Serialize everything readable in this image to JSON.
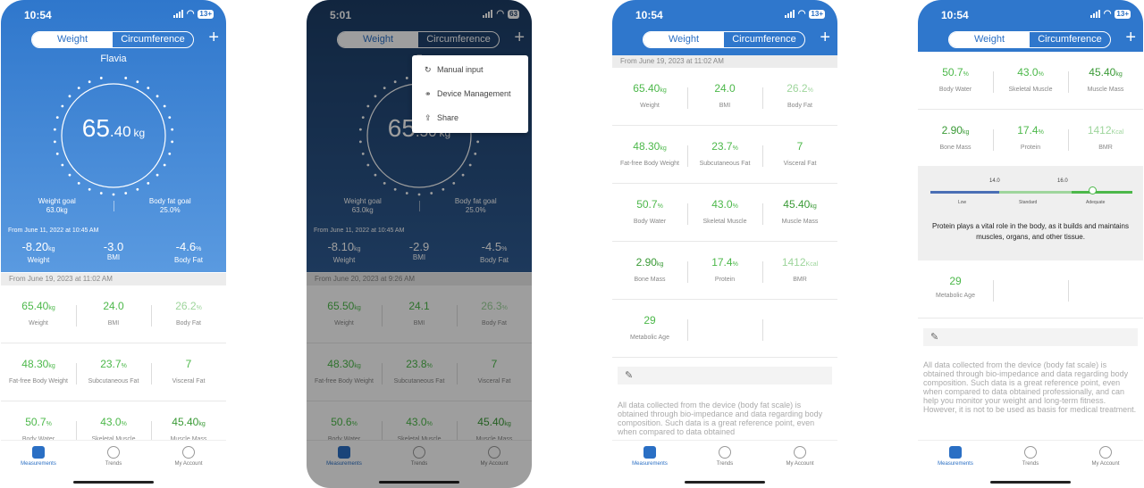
{
  "colors": {
    "brand_blue": "#2f77cc",
    "green": "#4cb84a",
    "light_green": "#9ed59c"
  },
  "tabs": {
    "measurements": "Measurements",
    "trends": "Trends",
    "account": "My Account"
  },
  "seg": {
    "weight": "Weight",
    "circ": "Circumference"
  },
  "icons": {
    "plus": "+",
    "note": "✎",
    "measurements": "shield-icon",
    "trends": "pulse-icon",
    "account": "person-icon"
  },
  "s1": {
    "time": "10:54",
    "battery": "13+",
    "user": "Flavia",
    "weight": "65",
    "weight_dec": ".40",
    "unit": "kg",
    "goals": [
      {
        "label": "Weight goal",
        "value": "63.0kg"
      },
      {
        "label": "Body fat goal",
        "value": "25.0%"
      }
    ],
    "since": "From June 11, 2022 at 10:45 AM",
    "deltas": [
      {
        "v": "-8.20",
        "u": "kg",
        "l": "Weight"
      },
      {
        "v": "-3.0",
        "u": "",
        "l": "BMI"
      },
      {
        "v": "-4.6",
        "u": "%",
        "l": "Body Fat"
      }
    ],
    "date": "From June 19, 2023 at 11:02 AM",
    "rows": [
      [
        {
          "v": "65.40",
          "u": "kg",
          "l": "Weight"
        },
        {
          "v": "24.0",
          "u": "",
          "l": "BMI"
        },
        {
          "v": "26.2",
          "u": "%",
          "l": "Body Fat"
        }
      ],
      [
        {
          "v": "48.30",
          "u": "kg",
          "l": "Fat-free Body Weight"
        },
        {
          "v": "23.7",
          "u": "%",
          "l": "Subcutaneous Fat"
        },
        {
          "v": "7",
          "u": "",
          "l": "Visceral Fat"
        }
      ],
      [
        {
          "v": "50.7",
          "u": "%",
          "l": "Body Water"
        },
        {
          "v": "43.0",
          "u": "%",
          "l": "Skeletal Muscle"
        },
        {
          "v": "45.40",
          "u": "kg",
          "l": "Muscle Mass"
        }
      ]
    ]
  },
  "s2": {
    "time": "5:01",
    "battery": "63",
    "user": "F",
    "weight": "65",
    "weight_dec": ".50",
    "unit": "kg",
    "menu": [
      {
        "icon": "↻",
        "label": "Manual input"
      },
      {
        "icon": "⚭",
        "label": "Device Management"
      },
      {
        "icon": "⇪",
        "label": "Share"
      }
    ],
    "goals": [
      {
        "label": "Weight goal",
        "value": "63.0kg"
      },
      {
        "label": "Body fat goal",
        "value": "25.0%"
      }
    ],
    "since": "From June 11, 2022 at 10:45 AM",
    "deltas": [
      {
        "v": "-8.10",
        "u": "kg",
        "l": "Weight"
      },
      {
        "v": "-2.9",
        "u": "",
        "l": "BMI"
      },
      {
        "v": "-4.5",
        "u": "%",
        "l": "Body Fat"
      }
    ],
    "date": "From June 20, 2023 at 9:26 AM",
    "rows": [
      [
        {
          "v": "65.50",
          "u": "kg",
          "l": "Weight"
        },
        {
          "v": "24.1",
          "u": "",
          "l": "BMI"
        },
        {
          "v": "26.3",
          "u": "%",
          "l": "Body Fat"
        }
      ],
      [
        {
          "v": "48.30",
          "u": "kg",
          "l": "Fat-free Body Weight"
        },
        {
          "v": "23.8",
          "u": "%",
          "l": "Subcutaneous Fat"
        },
        {
          "v": "7",
          "u": "",
          "l": "Visceral Fat"
        }
      ],
      [
        {
          "v": "50.6",
          "u": "%",
          "l": "Body Water"
        },
        {
          "v": "43.0",
          "u": "%",
          "l": "Skeletal Muscle"
        },
        {
          "v": "45.40",
          "u": "kg",
          "l": "Muscle Mass"
        }
      ]
    ]
  },
  "s3": {
    "time": "10:54",
    "battery": "13+",
    "date": "From June 19, 2023 at 11:02 AM",
    "rows": [
      [
        {
          "v": "65.40",
          "u": "kg",
          "l": "Weight"
        },
        {
          "v": "24.0",
          "u": "",
          "l": "BMI"
        },
        {
          "v": "26.2",
          "u": "%",
          "l": "Body Fat"
        }
      ],
      [
        {
          "v": "48.30",
          "u": "kg",
          "l": "Fat-free Body Weight"
        },
        {
          "v": "23.7",
          "u": "%",
          "l": "Subcutaneous Fat"
        },
        {
          "v": "7",
          "u": "",
          "l": "Visceral Fat"
        }
      ],
      [
        {
          "v": "50.7",
          "u": "%",
          "l": "Body Water"
        },
        {
          "v": "43.0",
          "u": "%",
          "l": "Skeletal Muscle"
        },
        {
          "v": "45.40",
          "u": "kg",
          "l": "Muscle Mass"
        }
      ],
      [
        {
          "v": "2.90",
          "u": "kg",
          "l": "Bone Mass"
        },
        {
          "v": "17.4",
          "u": "%",
          "l": "Protein"
        },
        {
          "v": "1412",
          "u": "Kcal",
          "l": "BMR"
        }
      ],
      [
        {
          "v": "29",
          "u": "",
          "l": "Metabolic Age"
        }
      ]
    ],
    "disclaimer": "All data collected from the device (body fat scale) is obtained through bio-impedance and data regarding body composition. Such data is a great reference point, even when compared to data obtained"
  },
  "s4": {
    "time": "10:54",
    "battery": "13+",
    "rows": [
      [
        {
          "v": "50.7",
          "u": "%",
          "l": "Body Water"
        },
        {
          "v": "43.0",
          "u": "%",
          "l": "Skeletal Muscle"
        },
        {
          "v": "45.40",
          "u": "kg",
          "l": "Muscle Mass"
        }
      ],
      [
        {
          "v": "2.90",
          "u": "kg",
          "l": "Bone Mass"
        },
        {
          "v": "17.4",
          "u": "%",
          "l": "Protein"
        },
        {
          "v": "1412",
          "u": "Kcal",
          "l": "BMR"
        }
      ]
    ],
    "protein": {
      "t1": "14.0",
      "t2": "16.0",
      "low": "Low",
      "std": "Standard",
      "adq": "Adequate",
      "value": 17.4,
      "min": 11,
      "max": 19,
      "desc": "Protein plays a vital role in the body, as it builds and maintains muscles, organs, and other tissue."
    },
    "meta": {
      "v": "29",
      "l": "Metabolic Age"
    },
    "disclaimer": "All data collected from the device (body fat scale) is obtained through bio-impedance and data regarding body composition. Such data is a great reference point, even when compared to data obtained professionally, and can help you monitor your weight and long-term fitness. However, it is not to be used as basis for medical treatment."
  }
}
